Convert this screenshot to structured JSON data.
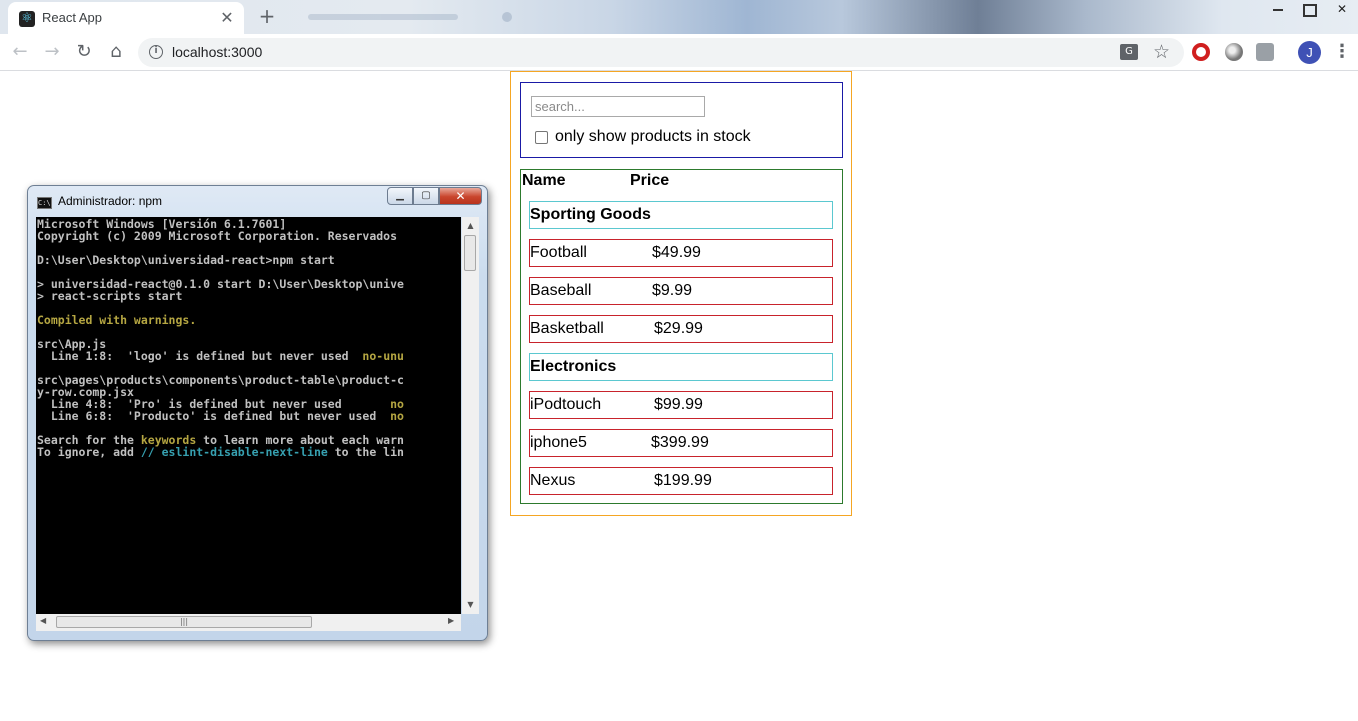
{
  "browser": {
    "tab_title": "React App",
    "tab_close": "✕",
    "new_tab": "+",
    "url": "localhost:3000",
    "profile_initial": "J",
    "menu": "⋮",
    "back": "←",
    "forward": "→",
    "reload": "↻",
    "home": "⌂",
    "star": "☆",
    "info": "i",
    "translate": "G"
  },
  "app": {
    "search": {
      "placeholder": "search..."
    },
    "stock_label": "only show products in stock",
    "table": {
      "header_name": "Name",
      "header_price": "Price",
      "rows": [
        {
          "type": "category",
          "name": "Sporting Goods"
        },
        {
          "type": "product",
          "name": "Football",
          "price": "$49.99"
        },
        {
          "type": "product",
          "name": "Baseball",
          "price": "$9.99"
        },
        {
          "type": "product",
          "name": "Basketball",
          "price": "$29.99"
        },
        {
          "type": "category",
          "name": "Electronics"
        },
        {
          "type": "product",
          "name": "iPodtouch",
          "price": "$99.99"
        },
        {
          "type": "product",
          "name": "iphone5",
          "price": "$399.99"
        },
        {
          "type": "product",
          "name": "Nexus",
          "price": "$199.99"
        }
      ]
    }
  },
  "console": {
    "title": "Administrador: npm",
    "icon_text": "C:\\",
    "close": "✕",
    "lines": [
      "Microsoft Windows [Versión 6.1.7601]",
      "Copyright (c) 2009 Microsoft Corporation. Reservados",
      "",
      "D:\\User\\Desktop\\universidad-react>npm start",
      "",
      "> universidad-react@0.1.0 start D:\\User\\Desktop\\unive",
      "> react-scripts start",
      "",
      "Compiled with warnings.",
      "",
      "src\\App.js",
      "  Line 1:8:  'logo' is defined but never used  no-unu",
      "",
      "src\\pages\\products\\components\\product-table\\product-c",
      "y-row.comp.jsx",
      "  Line 4:8:  'Pro' is defined but never used       no",
      "  Line 6:8:  'Producto' is defined but never used  no",
      "",
      "Search for the keywords to learn more about each warn",
      "To ignore, add // eslint-disable-next-line to the lin"
    ],
    "colored": {
      "compiled": "Compiled with warnings.",
      "line1_pre": "  Line 1:8:  'logo' is defined but never used  ",
      "line1_rule": "no-unu",
      "line4_pre": "  Line 4:8:  'Pro' is defined but never used       ",
      "line4_rule": "no",
      "line6_pre": "  Line 6:8:  'Producto' is defined but never used  ",
      "line6_rule": "no",
      "search_pre": "Search for the ",
      "search_kw": "keywords",
      "search_post": " to learn more about each warn",
      "ignore_pre": "To ignore, add ",
      "ignore_kw": "// eslint-disable-next-line",
      "ignore_post": " to the lin"
    }
  },
  "colors": {
    "app_border": "#f5a623",
    "search_border": "#1a1aa6",
    "table_border": "#2d7a2d",
    "category_border": "#5bc8d0",
    "product_border": "#c8232c",
    "terminal_yellow": "#b5a642",
    "terminal_cyan": "#36a0b0"
  }
}
